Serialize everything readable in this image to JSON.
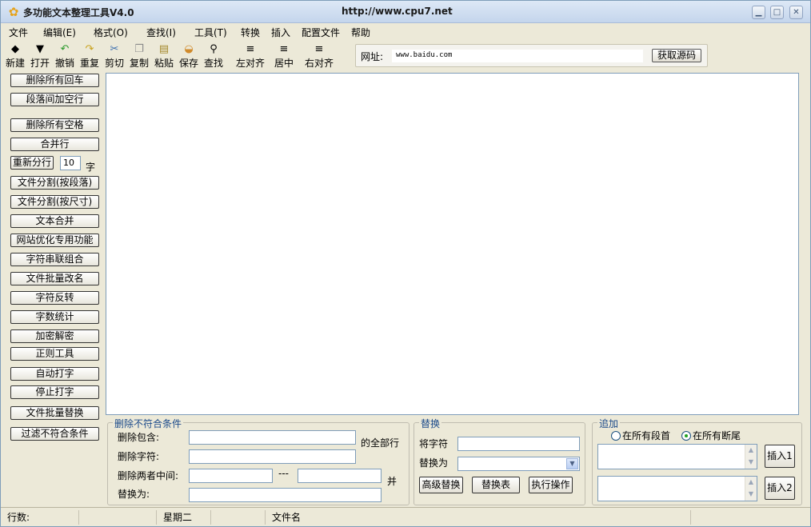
{
  "window": {
    "title": "多功能文本整理工具V4.0",
    "url": "http://www.cpu7.net",
    "minimize": "▁",
    "maximize": "□",
    "close": "✕"
  },
  "menu": [
    "文件",
    "编辑(E)",
    "格式(O)",
    "查找(I)",
    "工具(T)",
    "转换",
    "插入",
    "配置文件",
    "帮助"
  ],
  "toolbar": [
    {
      "label": "新建",
      "icon": "◆"
    },
    {
      "label": "打开",
      "icon": "▼"
    },
    {
      "label": "撤销",
      "icon": "↶"
    },
    {
      "label": "重复",
      "icon": "↷"
    },
    {
      "label": "剪切",
      "icon": "✂"
    },
    {
      "label": "复制",
      "icon": "❐"
    },
    {
      "label": "粘贴",
      "icon": "▤"
    },
    {
      "label": "保存",
      "icon": "◒"
    },
    {
      "label": "查找",
      "icon": "⚲"
    },
    {
      "label": "左对齐",
      "icon": "≡"
    },
    {
      "label": "居中",
      "icon": "≡"
    },
    {
      "label": "右对齐",
      "icon": "≡"
    }
  ],
  "url_bar": {
    "label": "网址:",
    "value": "www.baidu.com",
    "button": "获取源码"
  },
  "sidebar": [
    "删除所有回车",
    "段落间加空行",
    "删除所有空格",
    "合并行",
    "重新分行",
    "文件分割(按段落)",
    "文件分割(按尺寸)",
    "文本合并",
    "网站优化专用功能",
    "字符串联组合",
    "文件批量改名",
    "字符反转",
    "字数统计",
    "加密解密",
    "正则工具",
    "自动打字",
    "停止打字",
    "文件批量替换",
    "过滤不符合条件"
  ],
  "split": {
    "value": "10",
    "unit": "字"
  },
  "delete_group": {
    "title": "删除不符合条件",
    "contains_label": "删除包含:",
    "all_lines": "的全部行",
    "chars_label": "删除字符:",
    "between_label": "删除两者中间:",
    "dash": "---",
    "and": "并",
    "replace_label": "替换为:"
  },
  "replace_group": {
    "title": "替换",
    "from_label": "将字符",
    "to_label": "替换为",
    "advanced": "高级替换",
    "table": "替换表",
    "execute": "执行操作"
  },
  "append_group": {
    "title": "追加",
    "option_head": "在所有段首",
    "option_tail": "在所有断尾",
    "selected": "在所有断尾",
    "insert1": "插入1",
    "insert2": "插入2"
  },
  "status": {
    "lines": "行数:",
    "weekday": "星期二",
    "filename": "文件名"
  }
}
